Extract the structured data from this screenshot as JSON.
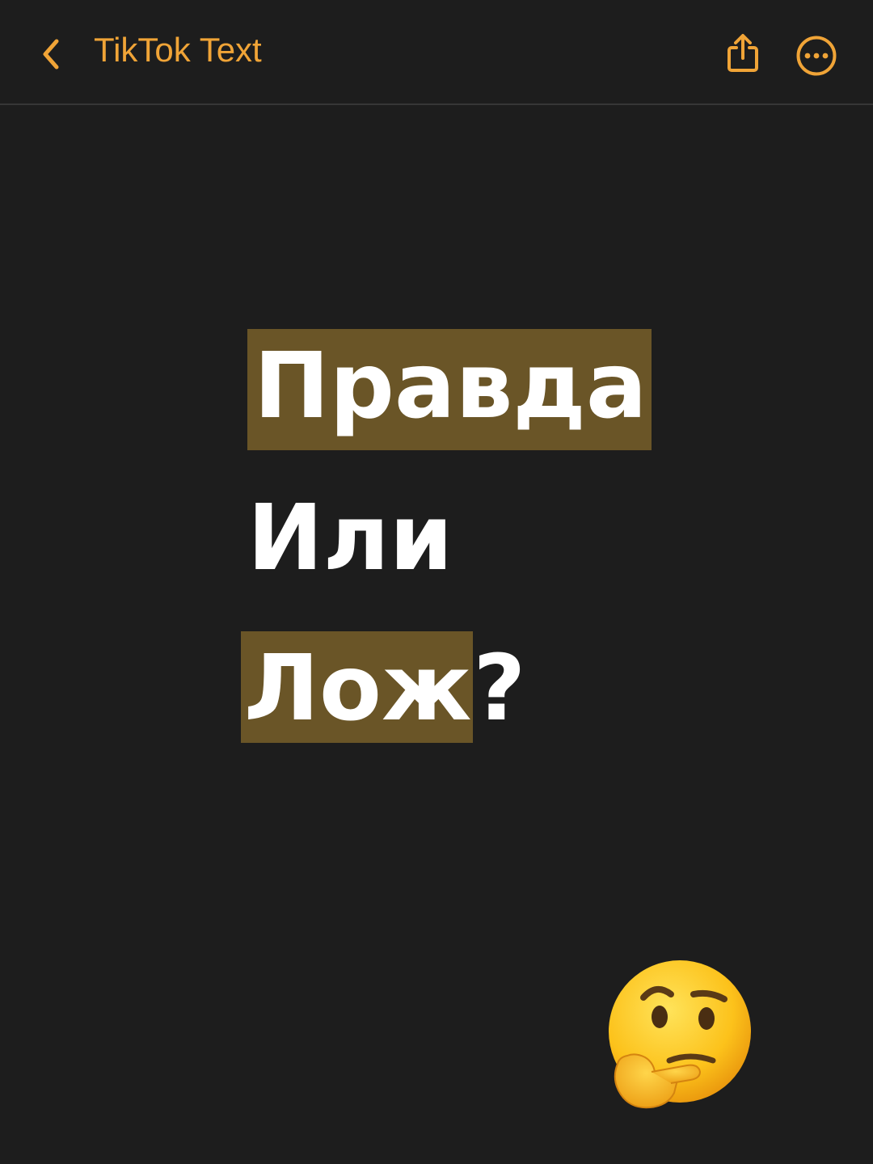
{
  "nav": {
    "back_icon": "chevron-left-icon",
    "title": "TikTok Text",
    "share_icon": "share-icon",
    "more_icon": "ellipsis-circle-icon"
  },
  "note": {
    "line1": "Правда",
    "line2": "Или",
    "line3_highlighted": "Лож",
    "line3_rest": "?",
    "emoji": "thinking-face-emoji"
  },
  "colors": {
    "background": "#1d1d1d",
    "accent": "#f0a437",
    "text": "#ffffff",
    "highlight": "#6a5527",
    "divider": "#363636"
  }
}
